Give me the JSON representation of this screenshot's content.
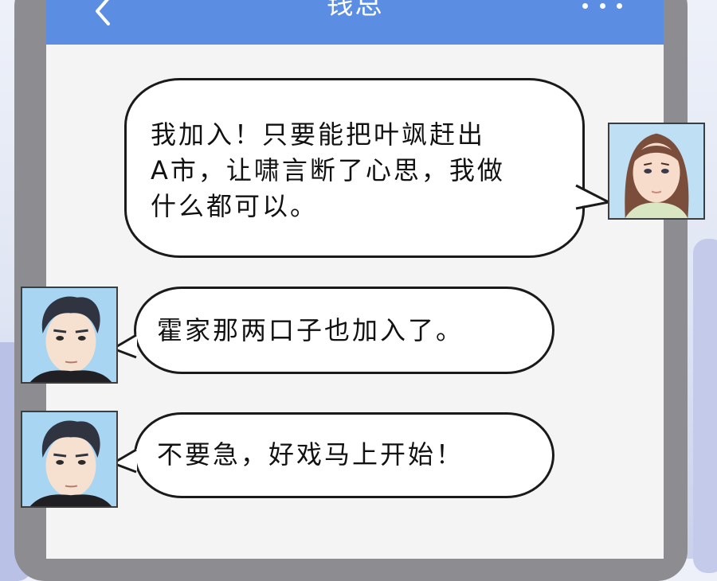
{
  "header": {
    "title": "钱总",
    "back_icon": "chevron-left-icon",
    "menu_icon": "more-dots-icon",
    "background_color": "#5b8de3"
  },
  "messages": [
    {
      "sender": "incoming-woman",
      "side": "right",
      "lines": [
        "我加入！只要能把叶飒赶出",
        "A市，让啸言断了心思，我做",
        "什么都可以。"
      ]
    },
    {
      "sender": "outgoing-man",
      "side": "left",
      "lines": [
        "霍家那两口子也加入了。"
      ]
    },
    {
      "sender": "outgoing-man",
      "side": "left",
      "lines": [
        "不要急，好戏马上开始！"
      ]
    }
  ],
  "colors": {
    "bubble_fill": "#ffffff",
    "bubble_border": "#1a1a1a",
    "chat_background": "#f4f4f4"
  }
}
